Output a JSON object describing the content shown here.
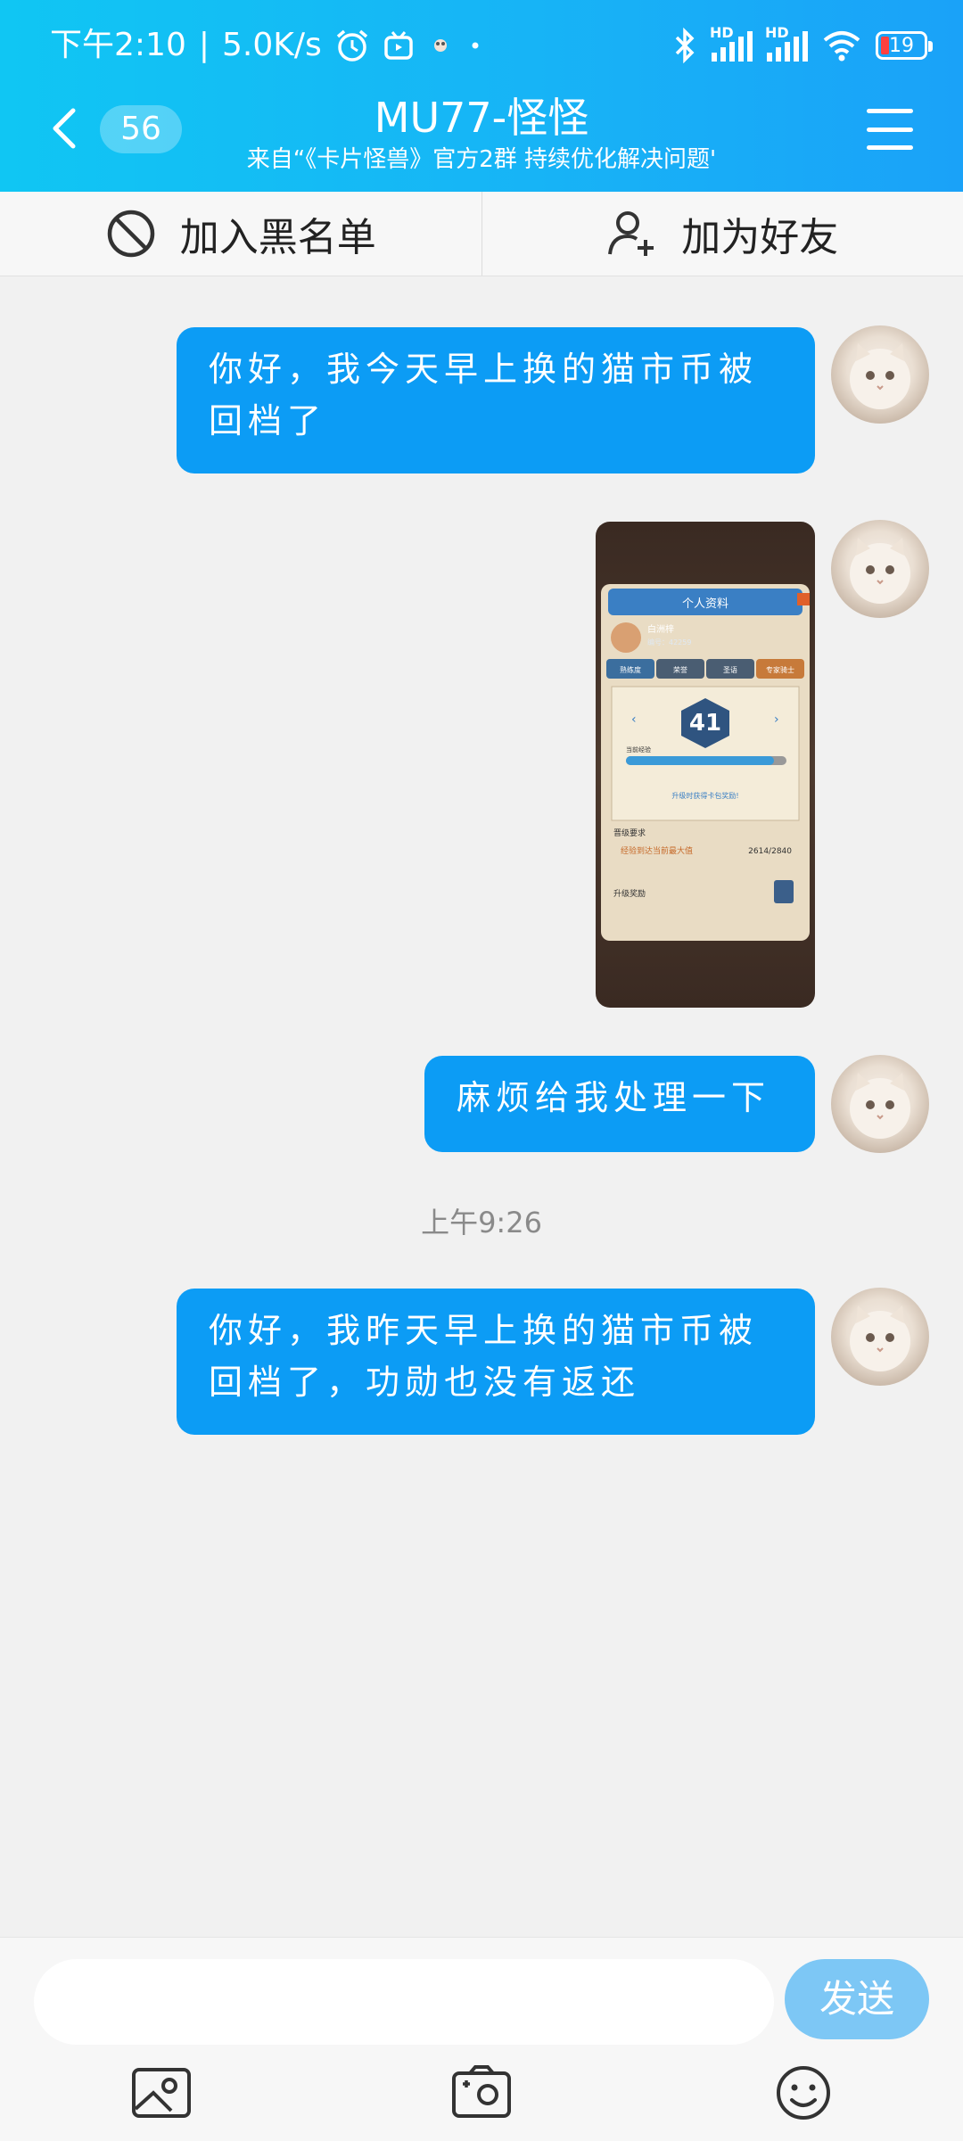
{
  "status_bar": {
    "time": "下午2:10",
    "separator": "|",
    "speed": "5.0K/s",
    "hd1": "HD",
    "hd2": "HD",
    "battery": "19",
    "icons": [
      "alarm-icon",
      "tv-icon",
      "app-icon",
      "dot-icon",
      "bluetooth-icon",
      "signal-icon",
      "signal-icon",
      "wifi-icon",
      "battery-icon"
    ]
  },
  "nav": {
    "unread_count": "56",
    "title": "MU77-怪怪",
    "subtitle": "来自“《卡片怪兽》官方2群 持续优化解决问题'"
  },
  "actions": {
    "block": "加入黑名单",
    "add_friend": "加为好友"
  },
  "messages": [
    {
      "type": "text",
      "text": "你好，我今天早上换的猫市币被回档了"
    },
    {
      "type": "image",
      "description": "game-screenshot"
    },
    {
      "type": "text",
      "text": "麻烦给我处理一下"
    },
    {
      "type": "text",
      "text": "你好，我昨天早上换的猫市币被回档了，功勋也没有返还"
    }
  ],
  "timestamp": "上午9:26",
  "game_shot": {
    "header": "个人资料",
    "name": "白洲梓",
    "id": "编号：42259",
    "tabs": [
      "熟练度",
      "荣誉",
      "圣语",
      "专家骑士"
    ],
    "level": "41",
    "bar_label": "当前经验",
    "hint": "升级时获得卡包奖励!",
    "req_title": "晋级要求",
    "req_text": "经验到达当前最大值",
    "req_value": "2614/2840",
    "reward": "升级奖励"
  },
  "input": {
    "placeholder": "",
    "send": "发送"
  },
  "colors": {
    "header": "#17b4f6",
    "bubble": "#0c9cf5",
    "send_button": "#7dc7f5",
    "background": "#f1f1f1"
  }
}
